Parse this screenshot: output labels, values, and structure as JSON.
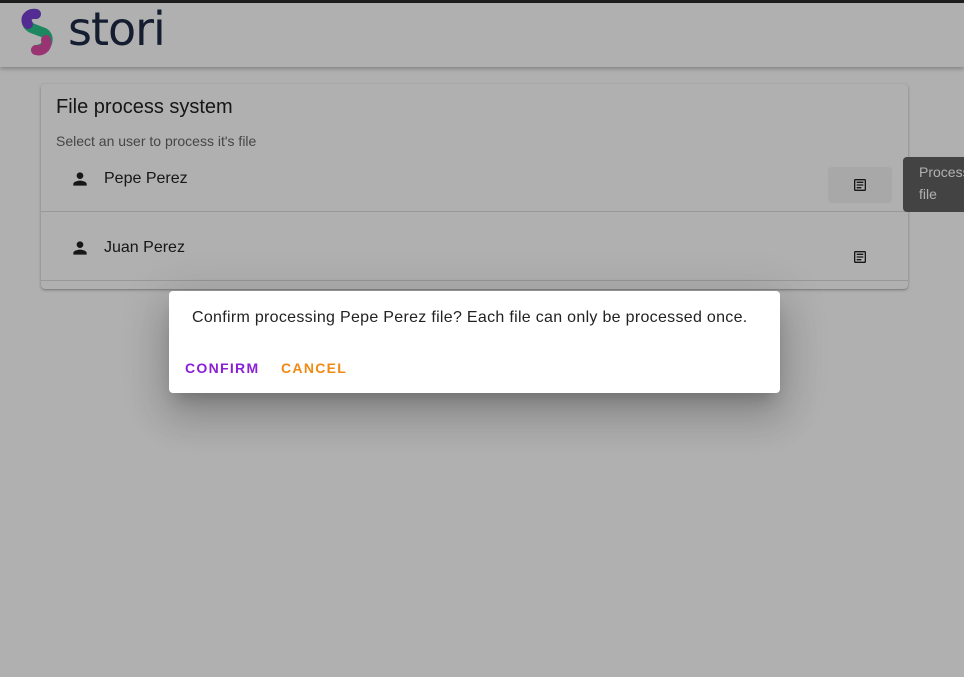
{
  "brand": {
    "name": "stori",
    "colors": {
      "accent_green": "#2bc48a",
      "accent_purple": "#7a3fd6",
      "accent_pink": "#e04aa6",
      "text": "#1f2a48"
    }
  },
  "card": {
    "title": "File process system",
    "subtitle": "Select an user to process it's file"
  },
  "users": [
    {
      "name": "Pepe Perez",
      "icon": "person-icon",
      "action_icon": "file-text-icon"
    },
    {
      "name": "Juan Perez",
      "icon": "person-icon",
      "action_icon": "file-text-icon"
    }
  ],
  "tooltip": {
    "line1": "Process",
    "line2": "file"
  },
  "dialog": {
    "message": "Confirm processing Pepe Perez file? Each file can only be processed once.",
    "confirm_label": "CONFIRM",
    "cancel_label": "CANCEL",
    "confirm_color": "#8a1fd6",
    "cancel_color": "#f08a12"
  }
}
